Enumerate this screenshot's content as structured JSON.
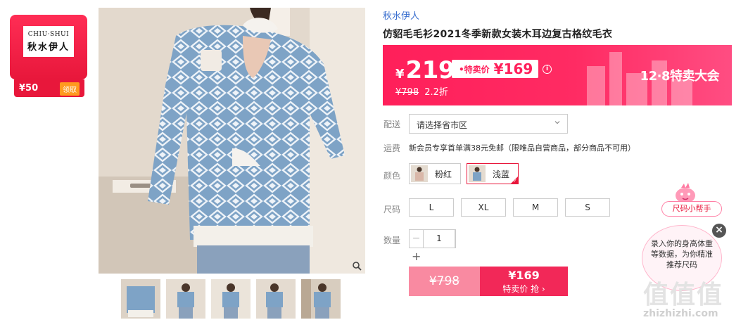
{
  "brand_badge": {
    "logo_en": "CHIU·SHUI",
    "logo_cn": "秋水伊人",
    "coupon_amount": "¥50",
    "coupon_action": "领取"
  },
  "product": {
    "brand": "秋水伊人",
    "title": "仿貂毛毛衫2021冬季新款女装木耳边复古格纹毛衣"
  },
  "price": {
    "currency": "¥",
    "current": "219",
    "special_label": "•特卖价",
    "special_price": "¥169",
    "original": "¥798",
    "discount": "2.2折",
    "event": "12·8特卖大会",
    "info_icon": "i"
  },
  "shipping": {
    "label": "配送",
    "placeholder": "请选择省市区"
  },
  "freight": {
    "label": "运费",
    "text": "新会员专享首单满38元免邮（限唯品自营商品，部分商品不可用）"
  },
  "colors": {
    "label": "颜色",
    "options": [
      {
        "name": "粉红",
        "selected": false
      },
      {
        "name": "浅蓝",
        "selected": true
      }
    ]
  },
  "sizes": {
    "label": "尺码",
    "options": [
      "L",
      "XL",
      "M",
      "S"
    ]
  },
  "quantity": {
    "label": "数量",
    "minus": "−",
    "value": "1",
    "plus": "+"
  },
  "buy": {
    "original_price": "¥798",
    "special_price": "¥169",
    "special_label": "特卖价 抢 ›"
  },
  "size_helper": {
    "label": "尺码小帮手",
    "bubble_text": "录入你的身高体重等数据，为你精准推荐尺码",
    "close": "×"
  },
  "watermark": {
    "chars": "值值值",
    "url": "zhizhizhi.com"
  },
  "colors_theme": {
    "accent": "#e8173b",
    "banner": "#ff2b63",
    "link": "#3a6fcf"
  }
}
